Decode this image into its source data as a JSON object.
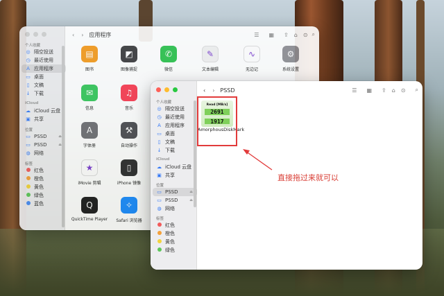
{
  "back_window": {
    "title": "应用程序",
    "sidebar": {
      "sections": [
        {
          "label": "个人收藏",
          "items": [
            {
              "icon": "airdrop-icon",
              "label": "隔空投送"
            },
            {
              "icon": "clock-icon",
              "label": "最近使用"
            },
            {
              "icon": "applications-icon",
              "label": "应用程序",
              "selected": true
            },
            {
              "icon": "desktop-icon",
              "label": "桌面"
            },
            {
              "icon": "document-icon",
              "label": "文稿"
            },
            {
              "icon": "download-icon",
              "label": "下载"
            }
          ]
        },
        {
          "label": "iCloud",
          "items": [
            {
              "icon": "cloud-icon",
              "label": "iCloud 云盘"
            },
            {
              "icon": "shared-folder-icon",
              "label": "共享"
            }
          ]
        },
        {
          "label": "位置",
          "items": [
            {
              "icon": "disk-icon",
              "label": "PSSD"
            },
            {
              "icon": "disk-icon",
              "label": "PSSD"
            },
            {
              "icon": "globe-icon",
              "label": "网络"
            }
          ]
        },
        {
          "label": "标签",
          "items": [
            {
              "color": "#f25b5b",
              "label": "红色"
            },
            {
              "color": "#f4a13a",
              "label": "橙色"
            },
            {
              "color": "#f3d33c",
              "label": "黄色"
            },
            {
              "color": "#5ec75a",
              "label": "绿色"
            },
            {
              "color": "#4a8df5",
              "label": "蓝色"
            }
          ]
        }
      ]
    },
    "apps": [
      {
        "name": "图书",
        "icon": "books-icon",
        "color": "#f59a1b",
        "glyph": "▤"
      },
      {
        "name": "图像捕捉",
        "icon": "image-capture-icon",
        "color": "#3a3a3c",
        "glyph": "◩"
      },
      {
        "name": "微信",
        "icon": "wechat-icon",
        "color": "#2bc24c",
        "glyph": "✆"
      },
      {
        "name": "文本编辑",
        "icon": "textedit-icon",
        "color": "#f1f1f1",
        "glyph": "✎"
      },
      {
        "name": "无边记",
        "icon": "freeform-icon",
        "color": "#ffffff",
        "glyph": "∿"
      },
      {
        "name": "系统设置",
        "icon": "settings-icon",
        "color": "#8e8e93",
        "glyph": "⚙"
      },
      {
        "name": "信息",
        "icon": "messages-icon",
        "color": "#34c759",
        "glyph": "✉"
      },
      {
        "name": "音乐",
        "icon": "music-icon",
        "color": "#fa3b50",
        "glyph": "♫"
      },
      {
        "name": "字体册",
        "icon": "fontbook-icon",
        "color": "#6e6e73",
        "glyph": "A"
      },
      {
        "name": "自动操作",
        "icon": "automator-icon",
        "color": "#4b4b50",
        "glyph": "⚒"
      },
      {
        "name": "iMovie 剪辑",
        "icon": "imovie-icon",
        "color": "#ffffff",
        "glyph": "★"
      },
      {
        "name": "iPhone 镜像",
        "icon": "iphone-mirroring-icon",
        "color": "#2c2c2e",
        "glyph": "▯"
      },
      {
        "name": "QuickTime Player",
        "icon": "quicktime-icon",
        "color": "#1c1c1e",
        "glyph": "Q"
      },
      {
        "name": "Safari 浏览器",
        "icon": "safari-icon",
        "color": "#1a8cff",
        "glyph": "✧"
      }
    ]
  },
  "front_window": {
    "title": "PSSD",
    "sidebar": {
      "sections": [
        {
          "label": "个人收藏",
          "items": [
            {
              "icon": "airdrop-icon",
              "label": "隔空投送"
            },
            {
              "icon": "clock-icon",
              "label": "最近使用"
            },
            {
              "icon": "applications-icon",
              "label": "应用程序"
            },
            {
              "icon": "desktop-icon",
              "label": "桌面"
            },
            {
              "icon": "document-icon",
              "label": "文稿"
            },
            {
              "icon": "download-icon",
              "label": "下载"
            }
          ]
        },
        {
          "label": "iCloud",
          "items": [
            {
              "icon": "cloud-icon",
              "label": "iCloud 云盘"
            },
            {
              "icon": "shared-folder-icon",
              "label": "共享"
            }
          ]
        },
        {
          "label": "位置",
          "items": [
            {
              "icon": "disk-icon",
              "label": "PSSD",
              "selected": true
            },
            {
              "icon": "disk-icon",
              "label": "PSSD"
            },
            {
              "icon": "globe-icon",
              "label": "网络"
            }
          ]
        },
        {
          "label": "标签",
          "items": [
            {
              "color": "#f25b5b",
              "label": "红色"
            },
            {
              "color": "#f4a13a",
              "label": "橙色"
            },
            {
              "color": "#f3d33c",
              "label": "黄色"
            },
            {
              "color": "#5ec75a",
              "label": "绿色"
            }
          ]
        }
      ]
    },
    "file": {
      "icon_title": "Read [MB/s]",
      "value1": "2691",
      "value2": "1917",
      "name": "AmorphousDiskMark"
    }
  },
  "annotation": "直接拖过来就可以",
  "colors": {
    "highlight": "#e23b3b",
    "annotation": "#d83b32",
    "accent": "#3478f6"
  }
}
